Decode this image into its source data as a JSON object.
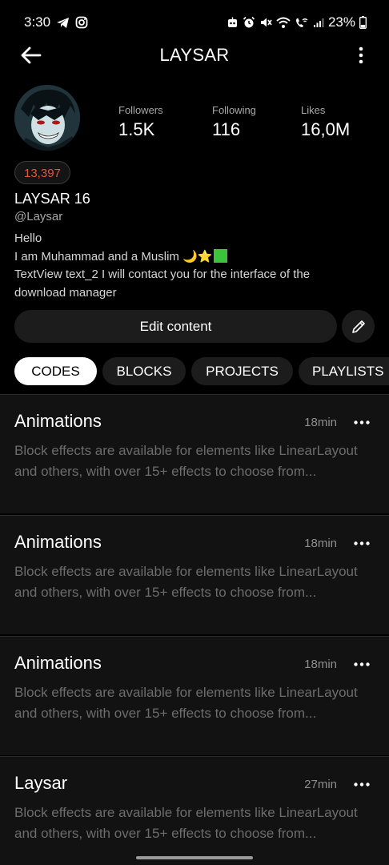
{
  "status_bar": {
    "time": "3:30",
    "battery": "23%",
    "icons_left": [
      "telegram-icon",
      "instagram-icon"
    ],
    "icons_right": [
      "robot-icon",
      "alarm-icon",
      "mute-icon",
      "wifi-icon",
      "wifi-call-icon",
      "signal-icon",
      "battery-icon"
    ]
  },
  "app_bar": {
    "title": "LAYSAR",
    "back_icon": "arrow-left-icon",
    "menu_icon": "more-vertical-icon"
  },
  "profile": {
    "stats": [
      {
        "label": "Followers",
        "value": "1.5K"
      },
      {
        "label": "Following",
        "value": "116"
      },
      {
        "label": "Likes",
        "value": "16,0M"
      }
    ],
    "badge": "13,397",
    "badge_color": "#e2583e",
    "name": "LAYSAR 16",
    "handle": "@Laysar",
    "bio_lines": [
      "Hello",
      " I am Muhammad and a Muslim ",
      "TextView text_2 I will contact you for the interface of the",
      "download manager"
    ],
    "bio_emoji": [
      "🌙",
      "⭐"
    ],
    "edit_button": "Edit content",
    "edit_icon": "pencil-icon"
  },
  "tabs": [
    {
      "label": "CODES",
      "active": true
    },
    {
      "label": "BLOCKS",
      "active": false
    },
    {
      "label": "PROJECTS",
      "active": false
    },
    {
      "label": "PLAYLISTS",
      "active": false
    }
  ],
  "posts": [
    {
      "title": "Animations",
      "time": "18min",
      "description": "Block effects are available for elements like LinearLayout and others, with over 15+ effects to choose from..."
    },
    {
      "title": "Animations",
      "time": "18min",
      "description": "Block effects are available for elements like LinearLayout and others, with over 15+ effects to choose from..."
    },
    {
      "title": "Animations",
      "time": "18min",
      "description": "Block effects are available for elements like LinearLayout and others, with over 15+ effects to choose from..."
    },
    {
      "title": "Laysar",
      "time": "27min",
      "description": "Block effects are available for elements like LinearLayout and others, with over 15+ effects to choose from..."
    }
  ],
  "colors": {
    "background": "#000000",
    "card_background": "#121212",
    "chip_background": "#1c1c1c",
    "muted_text": "#6c6c6c"
  }
}
